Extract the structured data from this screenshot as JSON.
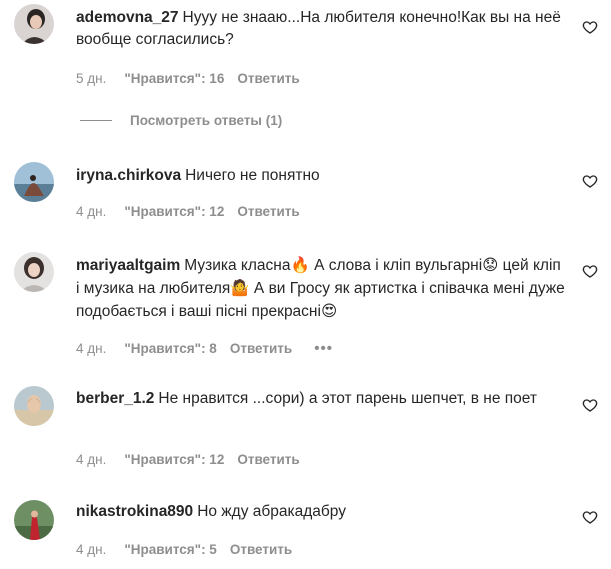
{
  "comments": [
    {
      "username": "ademovna_27",
      "text": "Нууу не знааю...На любителя конечно!Как вы на неё вообще согласились?",
      "time": "5 дн.",
      "likes": "\"Нравится\": 16",
      "reply": "Ответить",
      "avatar_icon": "avatar-photo"
    },
    {
      "username": "iryna.chirkova",
      "text": "Ничего не понятно",
      "time": "4 дн.",
      "likes": "\"Нравится\": 12",
      "reply": "Ответить",
      "avatar_icon": "avatar-photo"
    },
    {
      "username": "mariyaaltgaim",
      "text": "Музика класна",
      "text2": " А слова і кліп вульгарні",
      "text3": " цей кліп і музика на любителя",
      "text4": " А ви Гросу як артистка і співачка мені дуже подобається і ваші пісні прекрасні",
      "emoji1": "🔥",
      "emoji2": "😟",
      "emoji3": "🤷",
      "emoji4": "😍",
      "time": "4 дн.",
      "likes": "\"Нравится\": 8",
      "reply": "Ответить",
      "more": "•••",
      "avatar_icon": "avatar-photo"
    },
    {
      "username": "berber_1.2",
      "text": "Не нравится ...сори) а этот парень шепчет, в не поет",
      "time": "4 дн.",
      "likes": "\"Нравится\": 12",
      "reply": "Ответить",
      "avatar_icon": "avatar-photo"
    },
    {
      "username": "nikastrokina890",
      "text": "Но жду абракадабру",
      "time": "4 дн.",
      "likes": "\"Нравится\": 5",
      "reply": "Ответить",
      "avatar_icon": "avatar-photo"
    }
  ],
  "view_replies": "Посмотреть ответы (1)",
  "colors": {
    "text": "#262626",
    "secondary": "#8e8e8e"
  }
}
